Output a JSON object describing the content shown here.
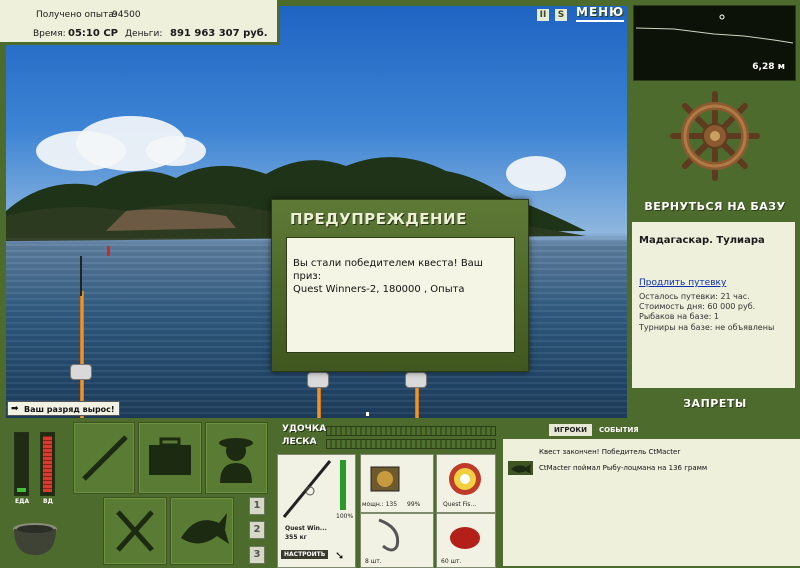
{
  "hud": {
    "xp_label": "Получено опыта:",
    "xp_value": "94500",
    "time_label": "Время:",
    "time_value": "05:10 СР",
    "money_label": "Деньги:",
    "money_value": "891 963 307 руб."
  },
  "top_controls": {
    "pause_icon": "pause-icon",
    "sound_icon": "sound-icon",
    "menu_label": "МЕНЮ"
  },
  "depth": {
    "value": "6,28 м"
  },
  "right_panel": {
    "return_base_label": "ВЕРНУТЬСЯ НА БАЗУ",
    "location": "Мадагаскар. Тулиара",
    "prolong_label": "Продлить путевку",
    "trip_left": "Осталось путевки: 21 час.",
    "day_cost": "Стоимость дня: 60 000 руб.",
    "anglers": "Рыбаков на базе: 1",
    "tournaments": "Турниры на базе: не объявлены",
    "bans_label": "ЗАПРЕТЫ"
  },
  "dialog": {
    "title": "ПРЕДУПРЕЖДЕНИЕ",
    "line1": "Вы стали победителем квеста! Ваш приз:",
    "line2": "Quest Winners-2, 180000 , Опыта"
  },
  "levelup": {
    "text": "Ваш разряд вырос!"
  },
  "gauges": {
    "food_label": "ЕДА",
    "hp_label": "ВД"
  },
  "number_buttons": [
    "1",
    "2",
    "3"
  ],
  "tackle": {
    "rod_label": "УДОЧКА",
    "line_label": "ЛЕСКА",
    "rod_name": "Quest Win...",
    "rod_weight": "355 кг",
    "rod_condition": "100%",
    "reel_label": "мощн.: 135",
    "reel_condition": "99%",
    "line_name": "Quest Fis...",
    "hook_count": "8 шт.",
    "bait_count": "60 шт.",
    "setup_label": "НАСТРОИТЬ"
  },
  "chat": {
    "tab_players": "ИГРОКИ",
    "tab_events": "СОБЫТИЯ",
    "msg1": "Квест закончен! Победитель CtMacter",
    "msg2": "CtMacter поймал Рыбу-лоцмана на 136 грамм"
  },
  "colors": {
    "panel_green": "#4e6b2e",
    "panel_light": "#eef0dc",
    "link_blue": "#0a2fb0"
  }
}
